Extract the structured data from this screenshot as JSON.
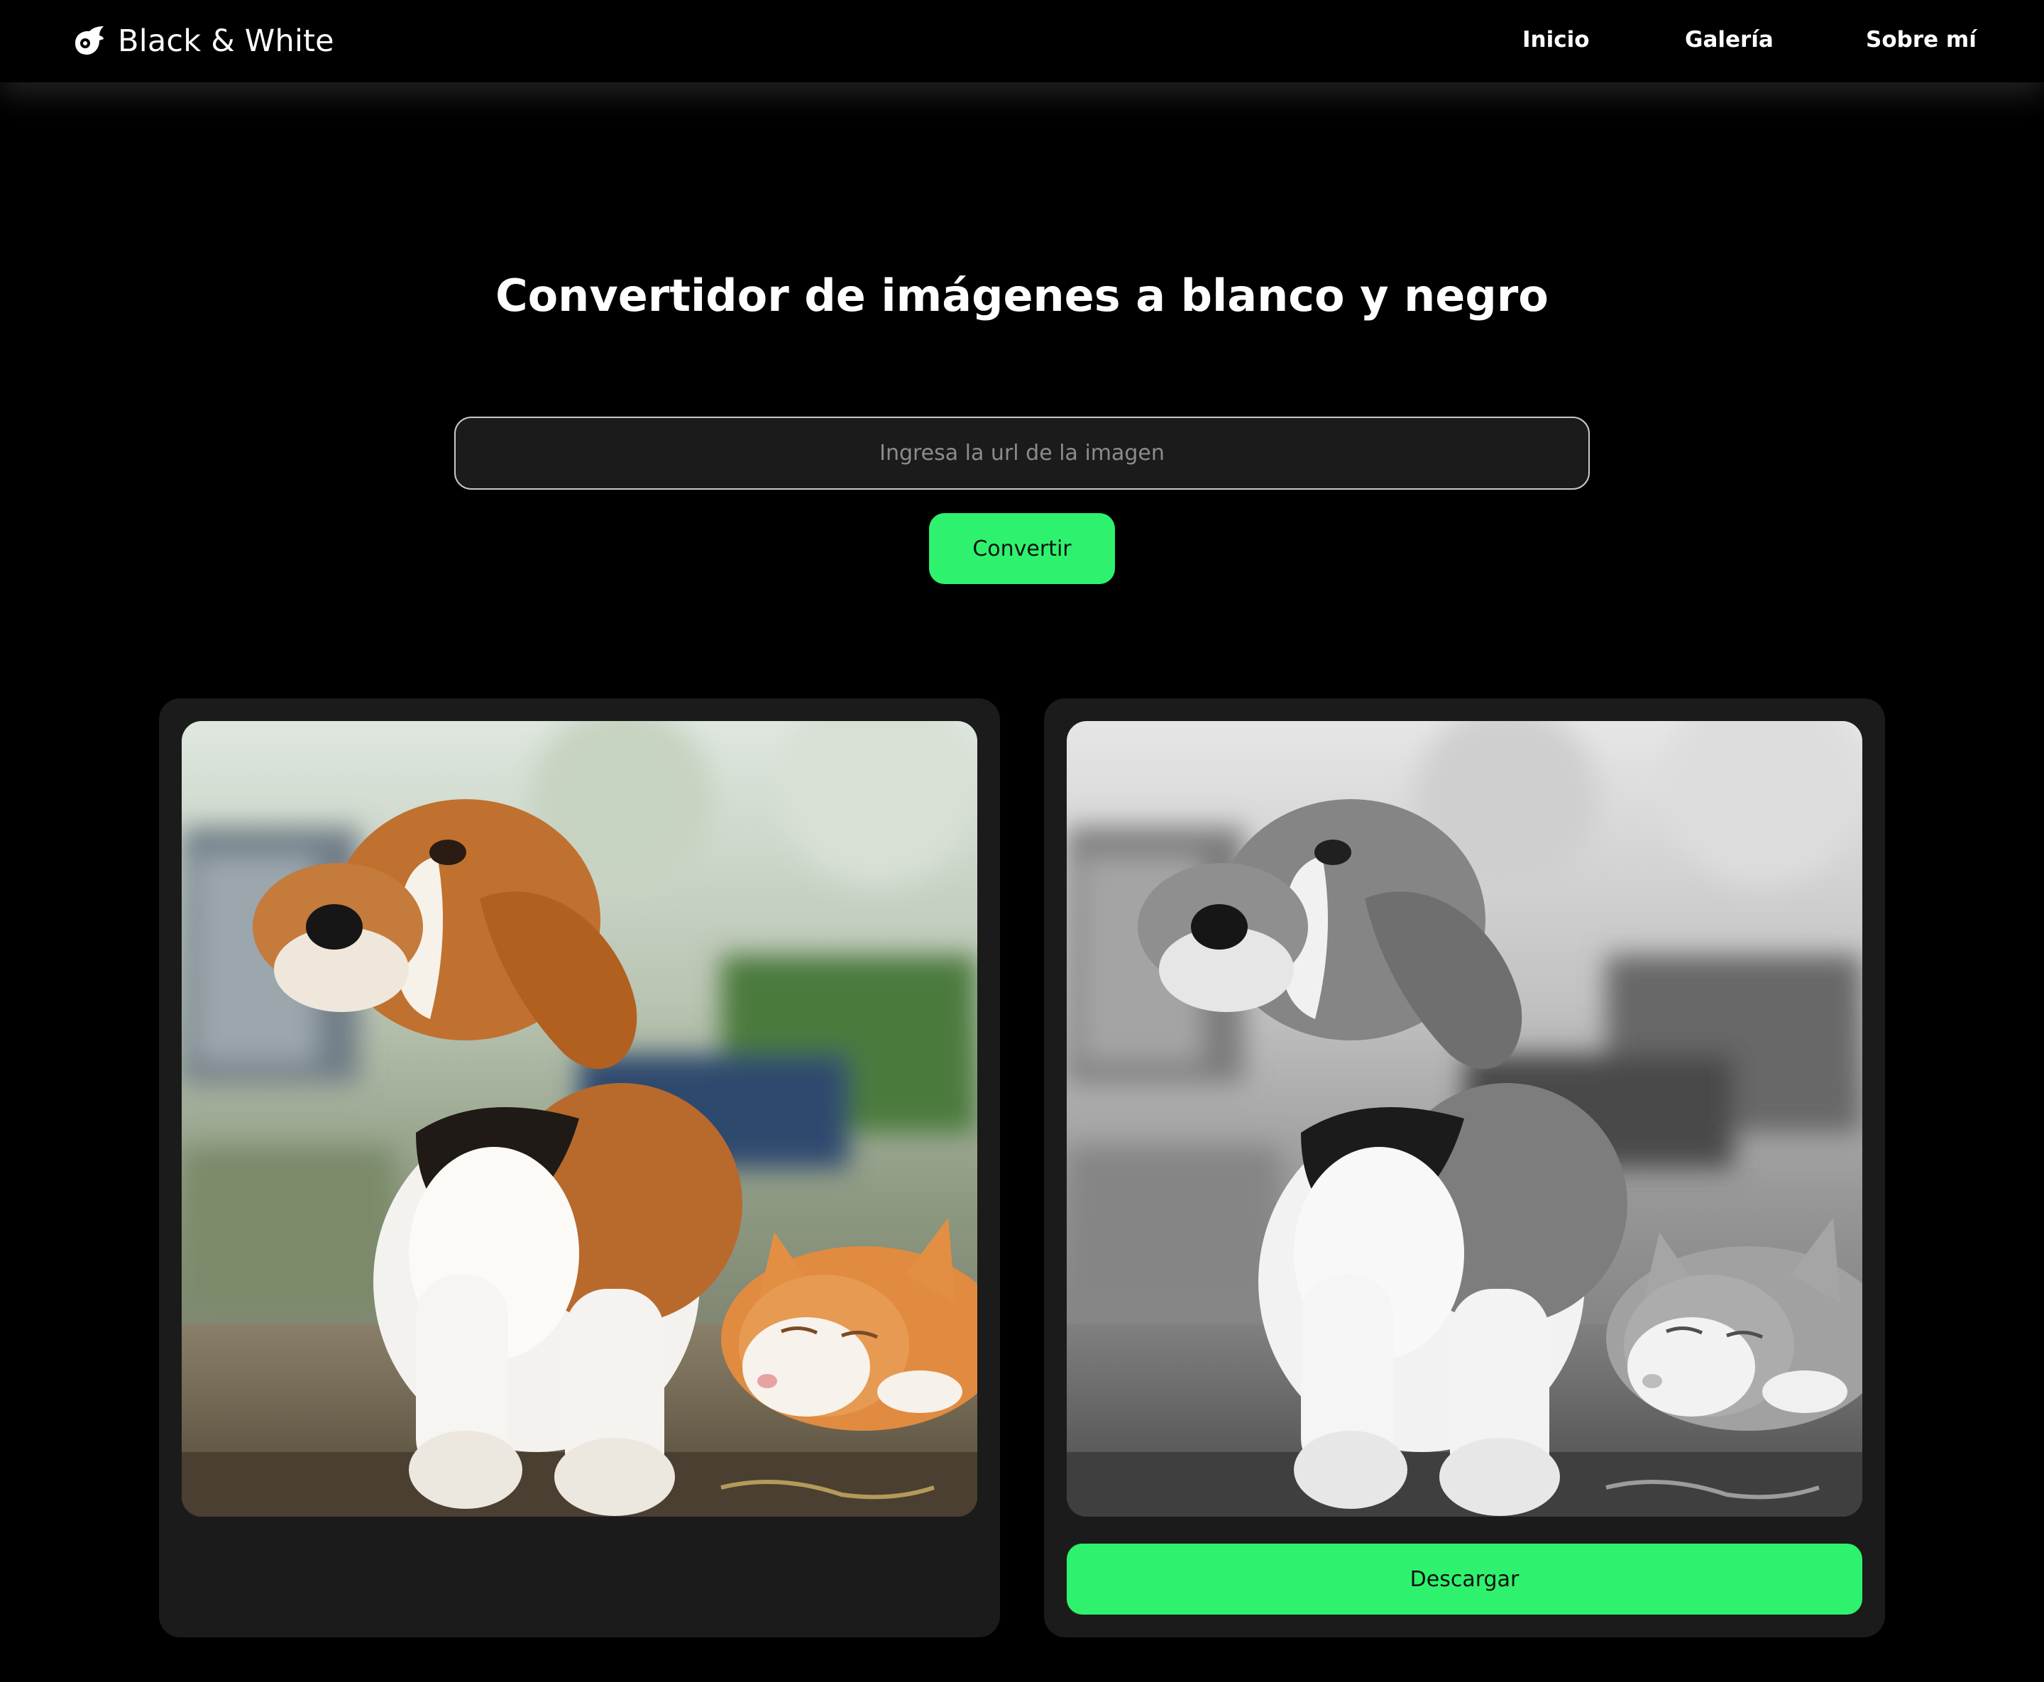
{
  "header": {
    "brand": "Black & White",
    "brand_icon": "bird-icon",
    "nav": [
      {
        "label": "Inicio"
      },
      {
        "label": "Galería"
      },
      {
        "label": "Sobre mí"
      }
    ]
  },
  "main": {
    "title": "Convertidor de imágenes a blanco y negro",
    "url_input": {
      "placeholder": "Ingresa la url de la imagen",
      "value": ""
    },
    "convert_label": "Convertir",
    "original_image_alt": "Beagle y gato naranja descansando sobre un bordillo",
    "converted_image_alt": "Beagle y gato en blanco y negro",
    "download_label": "Descargar"
  },
  "colors": {
    "background": "#000000",
    "card": "#1b1b1b",
    "accent": "#2ef26d",
    "input_border": "#c9c9c9"
  }
}
